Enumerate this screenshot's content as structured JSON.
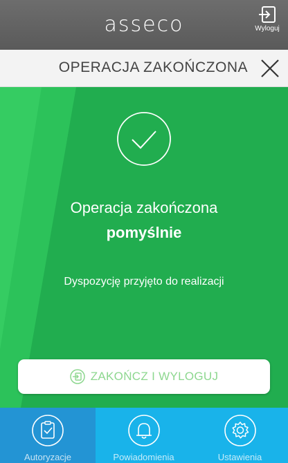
{
  "header": {
    "logo_text": "asseco",
    "logout_label": "Wyloguj"
  },
  "titlebar": {
    "title": "OPERACJA ZAKOŃCZONA"
  },
  "result": {
    "line1": "Operacja zakończona",
    "line2": "pomyślnie",
    "detail": "Dyspozycję przyjęto do realizacji"
  },
  "actions": {
    "finish_label": "ZAKOŃCZ I WYLOGUJ"
  },
  "nav": {
    "items": [
      {
        "label": "Autoryzacje",
        "icon": "clipboard-check-icon",
        "active": true
      },
      {
        "label": "Powiadomienia",
        "icon": "bell-icon",
        "active": false
      },
      {
        "label": "Ustawienia",
        "icon": "gear-icon",
        "active": false
      }
    ]
  },
  "colors": {
    "success_green": "#21ad4f",
    "header_gray": "#5a5a5a",
    "nav_blue": "#19b3ea",
    "nav_active": "#2394d4",
    "button_text": "#8dd78f"
  }
}
